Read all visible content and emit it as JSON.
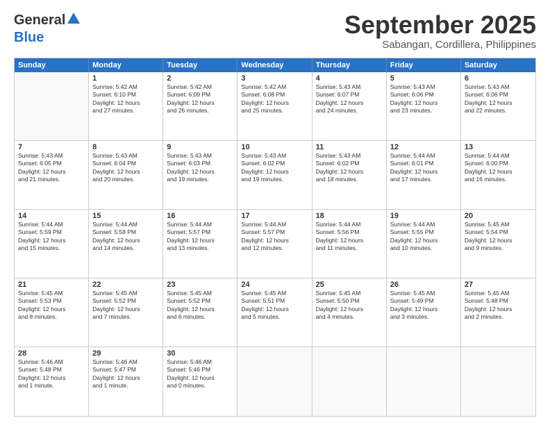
{
  "logo": {
    "general": "General",
    "blue": "Blue"
  },
  "title": "September 2025",
  "location": "Sabangan, Cordillera, Philippines",
  "days": [
    "Sunday",
    "Monday",
    "Tuesday",
    "Wednesday",
    "Thursday",
    "Friday",
    "Saturday"
  ],
  "weeks": [
    [
      {
        "date": "",
        "info": ""
      },
      {
        "date": "1",
        "info": "Sunrise: 5:42 AM\nSunset: 6:10 PM\nDaylight: 12 hours\nand 27 minutes."
      },
      {
        "date": "2",
        "info": "Sunrise: 5:42 AM\nSunset: 6:09 PM\nDaylight: 12 hours\nand 26 minutes."
      },
      {
        "date": "3",
        "info": "Sunrise: 5:42 AM\nSunset: 6:08 PM\nDaylight: 12 hours\nand 25 minutes."
      },
      {
        "date": "4",
        "info": "Sunrise: 5:43 AM\nSunset: 6:07 PM\nDaylight: 12 hours\nand 24 minutes."
      },
      {
        "date": "5",
        "info": "Sunrise: 5:43 AM\nSunset: 6:06 PM\nDaylight: 12 hours\nand 23 minutes."
      },
      {
        "date": "6",
        "info": "Sunrise: 5:43 AM\nSunset: 6:06 PM\nDaylight: 12 hours\nand 22 minutes."
      }
    ],
    [
      {
        "date": "7",
        "info": "Sunrise: 5:43 AM\nSunset: 6:05 PM\nDaylight: 12 hours\nand 21 minutes."
      },
      {
        "date": "8",
        "info": "Sunrise: 5:43 AM\nSunset: 6:04 PM\nDaylight: 12 hours\nand 20 minutes."
      },
      {
        "date": "9",
        "info": "Sunrise: 5:43 AM\nSunset: 6:03 PM\nDaylight: 12 hours\nand 19 minutes."
      },
      {
        "date": "10",
        "info": "Sunrise: 5:43 AM\nSunset: 6:02 PM\nDaylight: 12 hours\nand 19 minutes."
      },
      {
        "date": "11",
        "info": "Sunrise: 5:43 AM\nSunset: 6:02 PM\nDaylight: 12 hours\nand 18 minutes."
      },
      {
        "date": "12",
        "info": "Sunrise: 5:44 AM\nSunset: 6:01 PM\nDaylight: 12 hours\nand 17 minutes."
      },
      {
        "date": "13",
        "info": "Sunrise: 5:44 AM\nSunset: 6:00 PM\nDaylight: 12 hours\nand 16 minutes."
      }
    ],
    [
      {
        "date": "14",
        "info": "Sunrise: 5:44 AM\nSunset: 5:59 PM\nDaylight: 12 hours\nand 15 minutes."
      },
      {
        "date": "15",
        "info": "Sunrise: 5:44 AM\nSunset: 5:58 PM\nDaylight: 12 hours\nand 14 minutes."
      },
      {
        "date": "16",
        "info": "Sunrise: 5:44 AM\nSunset: 5:57 PM\nDaylight: 12 hours\nand 13 minutes."
      },
      {
        "date": "17",
        "info": "Sunrise: 5:44 AM\nSunset: 5:57 PM\nDaylight: 12 hours\nand 12 minutes."
      },
      {
        "date": "18",
        "info": "Sunrise: 5:44 AM\nSunset: 5:56 PM\nDaylight: 12 hours\nand 11 minutes."
      },
      {
        "date": "19",
        "info": "Sunrise: 5:44 AM\nSunset: 5:55 PM\nDaylight: 12 hours\nand 10 minutes."
      },
      {
        "date": "20",
        "info": "Sunrise: 5:45 AM\nSunset: 5:54 PM\nDaylight: 12 hours\nand 9 minutes."
      }
    ],
    [
      {
        "date": "21",
        "info": "Sunrise: 5:45 AM\nSunset: 5:53 PM\nDaylight: 12 hours\nand 8 minutes."
      },
      {
        "date": "22",
        "info": "Sunrise: 5:45 AM\nSunset: 5:52 PM\nDaylight: 12 hours\nand 7 minutes."
      },
      {
        "date": "23",
        "info": "Sunrise: 5:45 AM\nSunset: 5:52 PM\nDaylight: 12 hours\nand 6 minutes."
      },
      {
        "date": "24",
        "info": "Sunrise: 5:45 AM\nSunset: 5:51 PM\nDaylight: 12 hours\nand 5 minutes."
      },
      {
        "date": "25",
        "info": "Sunrise: 5:45 AM\nSunset: 5:50 PM\nDaylight: 12 hours\nand 4 minutes."
      },
      {
        "date": "26",
        "info": "Sunrise: 5:45 AM\nSunset: 5:49 PM\nDaylight: 12 hours\nand 3 minutes."
      },
      {
        "date": "27",
        "info": "Sunrise: 5:45 AM\nSunset: 5:48 PM\nDaylight: 12 hours\nand 2 minutes."
      }
    ],
    [
      {
        "date": "28",
        "info": "Sunrise: 5:46 AM\nSunset: 5:48 PM\nDaylight: 12 hours\nand 1 minute."
      },
      {
        "date": "29",
        "info": "Sunrise: 5:46 AM\nSunset: 5:47 PM\nDaylight: 12 hours\nand 1 minute."
      },
      {
        "date": "30",
        "info": "Sunrise: 5:46 AM\nSunset: 5:46 PM\nDaylight: 12 hours\nand 0 minutes."
      },
      {
        "date": "",
        "info": ""
      },
      {
        "date": "",
        "info": ""
      },
      {
        "date": "",
        "info": ""
      },
      {
        "date": "",
        "info": ""
      }
    ]
  ]
}
